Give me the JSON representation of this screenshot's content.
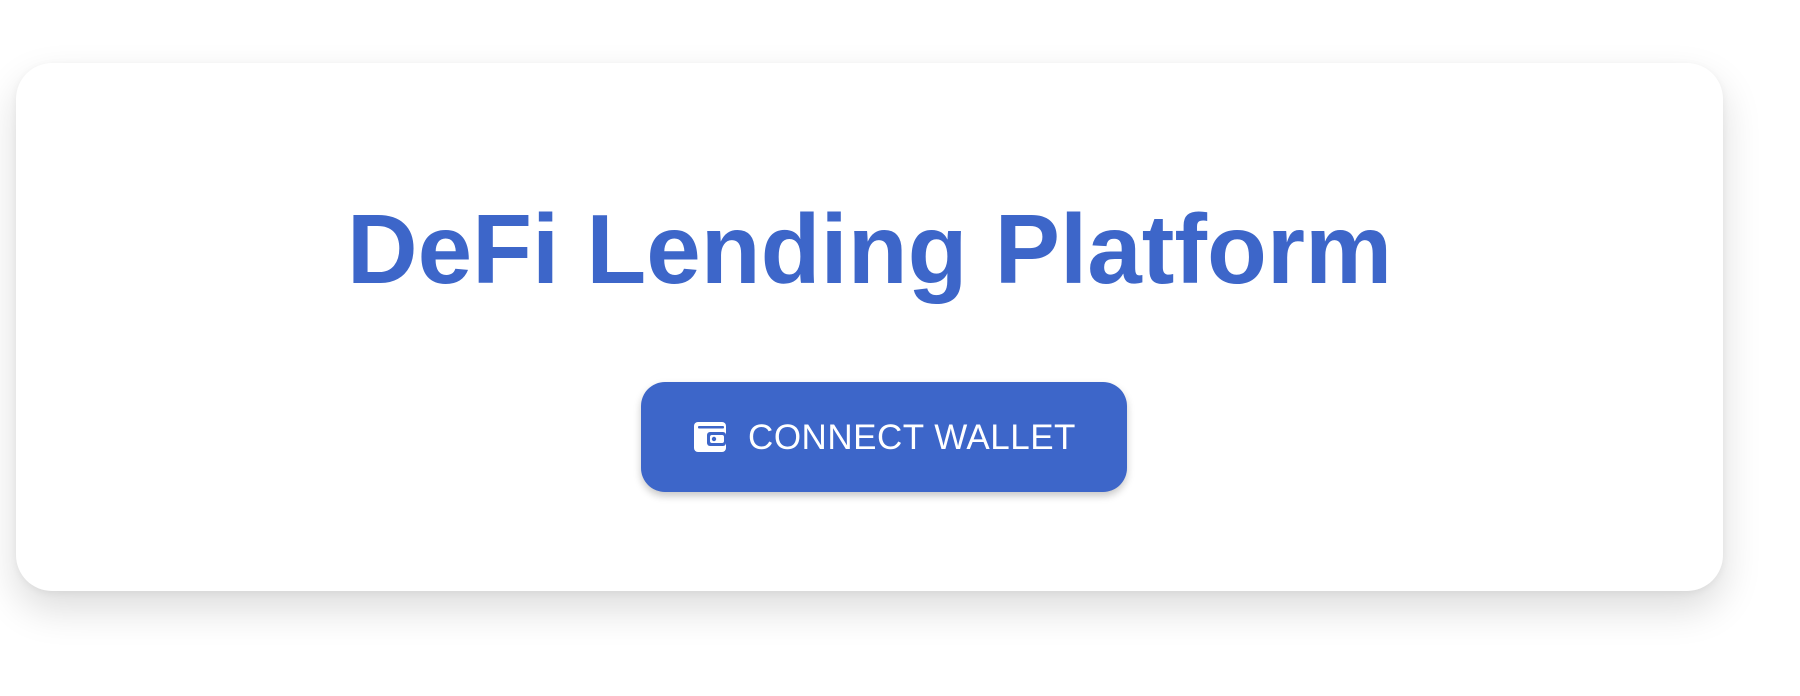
{
  "app": {
    "title": "DeFi Lending Platform"
  },
  "actions": {
    "connect_wallet_label": "CONNECT WALLET",
    "connect_wallet_icon": "wallet-icon"
  },
  "colors": {
    "accent": "#3d66c9",
    "background": "#ffffff",
    "button_text": "#ffffff"
  }
}
